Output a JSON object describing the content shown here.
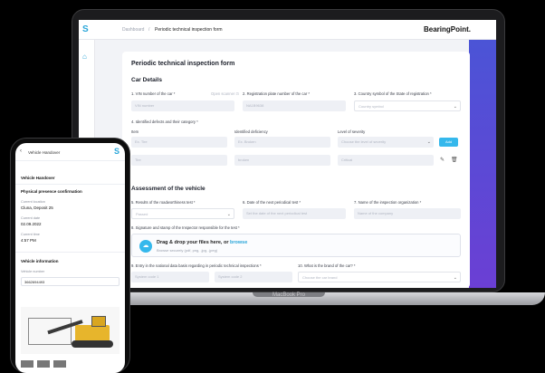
{
  "laptop": {
    "model_label": "MacBook Pro",
    "topbar": {
      "breadcrumb_root": "Dashboard",
      "breadcrumb_sep": "/",
      "breadcrumb_current": "Periodic technical inspection form",
      "brand": "BearingPoint."
    },
    "form": {
      "title": "Periodic technical inspection form",
      "car_details_title": "Car Details",
      "vin_label": "1. VIN number of the car *",
      "vin_hint": "Open scanner ⊡",
      "vin_placeholder": "VIN number",
      "plate_label": "2. Registration plate number of the car *",
      "plate_placeholder": "NA1B9638",
      "country_label": "3. Country symbol of the State of registration *",
      "country_placeholder": "Country symbol",
      "defects_label": "4. Identified defects and their category *",
      "col_item": "Item",
      "col_deficiency": "Identified deficiency",
      "col_severity": "Level of severity",
      "item_value": "Ex. Tire",
      "deficiency_value": "Ex. Broken",
      "severity_placeholder": "Choose the level of severity",
      "add_label": "Add",
      "row2_item": "Tire",
      "row2_deficiency": "broken",
      "row2_severity": "Critical",
      "assessment_title": "Assessment of the vehicle",
      "results_label": "5. Results of the roadworthiness test *",
      "results_placeholder": "Passed",
      "next_test_label": "6. Date of the next periodical test *",
      "next_test_placeholder": "Set the date of the next periodical test",
      "org_label": "7. Name of the inspection organization *",
      "org_placeholder": "Name of the company",
      "signature_label": "8. Signature and stamp of the Inspector responsible for the test *",
      "dropzone_text": "Drag & drop your files here, or",
      "dropzone_link": "browse",
      "dropzone_sub": "Browse securely (pdf, png, .jpg, .jpeg)",
      "entry_label": "9. Entry in the national data basis regarding in periodic technical inspections *",
      "entry_placeholder_a": "System code 1",
      "entry_placeholder_b": "System code 2",
      "brand_label": "10. What is the brand of the car? *",
      "brand_placeholder": "Choose the car brand"
    }
  },
  "phone": {
    "header_title": "Vehicle Handover",
    "section_handover": "Vehicle Handover",
    "section_presence": "Physical presence confirmation",
    "location_label": "Current location",
    "location_value": "Cluna, Deposit 25",
    "date_label": "Current date",
    "date_value": "02.09.2022",
    "time_label": "Current time",
    "time_value": "4:57 PM",
    "section_vehicle_info": "Vehicle information",
    "vehicle_number_label": "Vehicle number",
    "vehicle_number_value": "3662694493"
  },
  "colors": {
    "accent": "#35b8ec",
    "brand_gradient_top": "#4b54d6",
    "brand_gradient_bottom": "#6b3fd4",
    "machine_yellow": "#e7b52c"
  }
}
